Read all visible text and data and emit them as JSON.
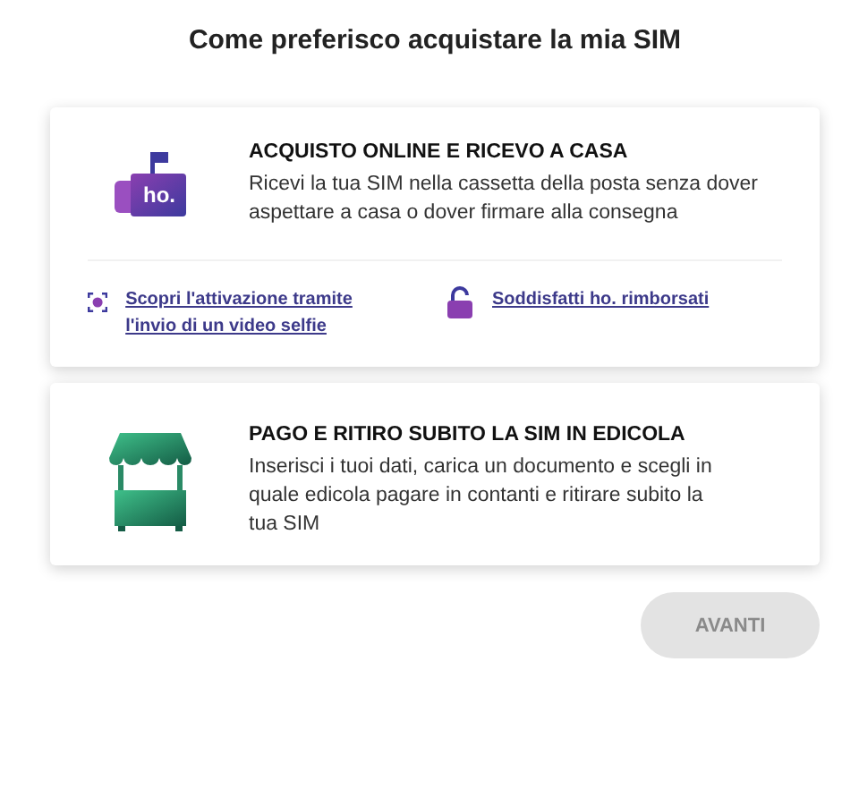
{
  "title": "Come preferisco acquistare la mia SIM",
  "options": [
    {
      "kind": "mailbox",
      "icon_text": "ho.",
      "heading": "ACQUISTO ONLINE E RICEVO A CASA",
      "description": "Ricevi la tua SIM nella cassetta della posta senza dover aspettare a casa o dover firmare alla consegna",
      "selected": false,
      "links": [
        {
          "kind": "face",
          "label": "Scopri l'attivazione tramite l'invio di un video selfie"
        },
        {
          "kind": "lock",
          "label": "Soddisfatti ho. rimborsati"
        }
      ]
    },
    {
      "kind": "kiosk",
      "heading": "PAGO E RITIRO SUBITO LA SIM IN EDICOLA",
      "description": "Inserisci i tuoi dati, carica un documento e scegli in quale edicola pagare in contanti e ritirare subito la tua SIM",
      "selected": false
    }
  ],
  "button": {
    "label": "AVANTI",
    "disabled": true
  }
}
